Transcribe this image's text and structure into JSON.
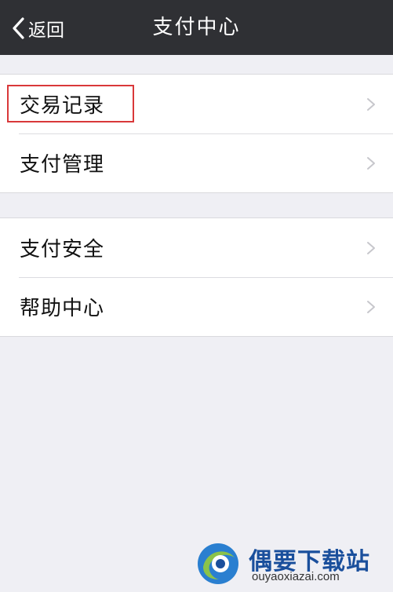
{
  "navbar": {
    "back_label": "返回",
    "title": "支付中心"
  },
  "groups": [
    {
      "items": [
        {
          "label": "交易记录",
          "highlighted": true
        },
        {
          "label": "支付管理"
        }
      ]
    },
    {
      "items": [
        {
          "label": "支付安全"
        },
        {
          "label": "帮助中心"
        }
      ]
    }
  ],
  "watermark": {
    "name": "偶要下载站",
    "url": "ouyaoxiazai.com"
  },
  "colors": {
    "navbar_bg": "#2f3034",
    "page_bg": "#efeff4",
    "highlight": "#d9383a",
    "chevron": "#c7c7cc",
    "watermark_blue": "#1a4f9c"
  }
}
